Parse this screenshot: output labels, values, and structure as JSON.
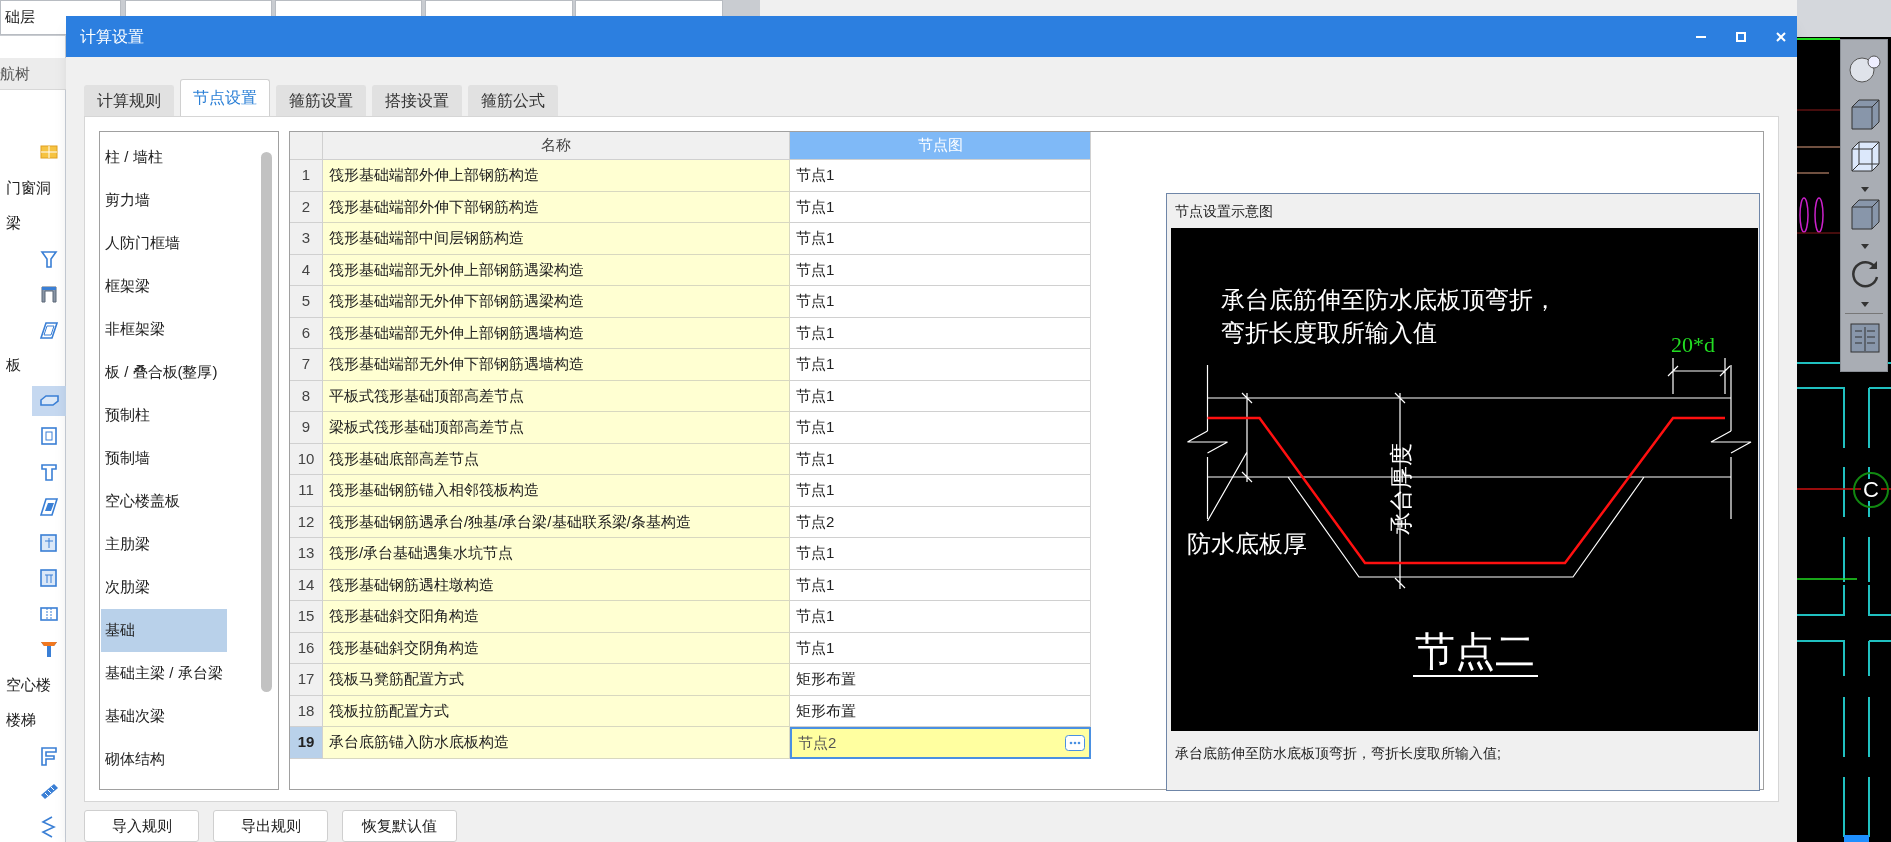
{
  "background": {
    "fields": [
      "础层"
    ],
    "nav_title": "航树",
    "nav_items": [
      {
        "kind": "icon",
        "selected": false
      },
      {
        "kind": "label",
        "text": "门窗洞",
        "selected": false
      },
      {
        "kind": "label",
        "text": "梁",
        "selected": false
      },
      {
        "kind": "icon",
        "selected": false
      },
      {
        "kind": "icon",
        "selected": false
      },
      {
        "kind": "icon",
        "selected": false
      },
      {
        "kind": "label",
        "text": "板",
        "selected": false
      },
      {
        "kind": "icon",
        "selected": true
      },
      {
        "kind": "icon",
        "selected": false
      },
      {
        "kind": "icon",
        "selected": false
      },
      {
        "kind": "icon",
        "selected": false
      },
      {
        "kind": "icon",
        "selected": false
      },
      {
        "kind": "icon",
        "selected": false
      },
      {
        "kind": "icon",
        "selected": false
      },
      {
        "kind": "icon",
        "selected": false
      },
      {
        "kind": "label",
        "text": "空心楼",
        "selected": false
      },
      {
        "kind": "label",
        "text": "楼梯",
        "selected": false
      },
      {
        "kind": "icon",
        "selected": false
      },
      {
        "kind": "icon",
        "selected": false
      },
      {
        "kind": "icon",
        "selected": false
      }
    ]
  },
  "dialog": {
    "title": "计算设置",
    "tabs": [
      {
        "label": "计算规则",
        "selected": false
      },
      {
        "label": "节点设置",
        "selected": true
      },
      {
        "label": "箍筋设置",
        "selected": false
      },
      {
        "label": "搭接设置",
        "selected": false
      },
      {
        "label": "箍筋公式",
        "selected": false
      }
    ],
    "categories": [
      {
        "label": "柱 / 墙柱",
        "selected": false
      },
      {
        "label": "剪力墙",
        "selected": false
      },
      {
        "label": "人防门框墙",
        "selected": false
      },
      {
        "label": "框架梁",
        "selected": false
      },
      {
        "label": "非框架梁",
        "selected": false
      },
      {
        "label": "板 / 叠合板(整厚)",
        "selected": false
      },
      {
        "label": "预制柱",
        "selected": false
      },
      {
        "label": "预制墙",
        "selected": false
      },
      {
        "label": "空心楼盖板",
        "selected": false
      },
      {
        "label": "主肋梁",
        "selected": false
      },
      {
        "label": "次肋梁",
        "selected": false
      },
      {
        "label": "基础",
        "selected": true
      },
      {
        "label": "基础主梁 / 承台梁",
        "selected": false
      },
      {
        "label": "基础次梁",
        "selected": false
      },
      {
        "label": "砌体结构",
        "selected": false
      }
    ],
    "table": {
      "columns": [
        {
          "label": "名称",
          "selected": false
        },
        {
          "label": "节点图",
          "selected": true
        }
      ],
      "rows": [
        {
          "num": "1",
          "name": "筏形基础端部外伸上部钢筋构造",
          "value": "节点1",
          "selected": false
        },
        {
          "num": "2",
          "name": "筏形基础端部外伸下部钢筋构造",
          "value": "节点1",
          "selected": false
        },
        {
          "num": "3",
          "name": "筏形基础端部中间层钢筋构造",
          "value": "节点1",
          "selected": false
        },
        {
          "num": "4",
          "name": "筏形基础端部无外伸上部钢筋遇梁构造",
          "value": "节点1",
          "selected": false
        },
        {
          "num": "5",
          "name": "筏形基础端部无外伸下部钢筋遇梁构造",
          "value": "节点1",
          "selected": false
        },
        {
          "num": "6",
          "name": "筏形基础端部无外伸上部钢筋遇墙构造",
          "value": "节点1",
          "selected": false
        },
        {
          "num": "7",
          "name": "筏形基础端部无外伸下部钢筋遇墙构造",
          "value": "节点1",
          "selected": false
        },
        {
          "num": "8",
          "name": "平板式筏形基础顶部高差节点",
          "value": "节点1",
          "selected": false
        },
        {
          "num": "9",
          "name": "梁板式筏形基础顶部高差节点",
          "value": "节点1",
          "selected": false
        },
        {
          "num": "10",
          "name": "筏形基础底部高差节点",
          "value": "节点1",
          "selected": false
        },
        {
          "num": "11",
          "name": "筏形基础钢筋锚入相邻筏板构造",
          "value": "节点1",
          "selected": false
        },
        {
          "num": "12",
          "name": "筏形基础钢筋遇承台/独基/承台梁/基础联系梁/条基构造",
          "value": "节点2",
          "selected": false
        },
        {
          "num": "13",
          "name": "筏形/承台基础遇集水坑节点",
          "value": "节点1",
          "selected": false
        },
        {
          "num": "14",
          "name": "筏形基础钢筋遇柱墩构造",
          "value": "节点1",
          "selected": false
        },
        {
          "num": "15",
          "name": "筏形基础斜交阳角构造",
          "value": "节点1",
          "selected": false
        },
        {
          "num": "16",
          "name": "筏形基础斜交阴角构造",
          "value": "节点1",
          "selected": false
        },
        {
          "num": "17",
          "name": "筏板马凳筋配置方式",
          "value": "矩形布置",
          "selected": false
        },
        {
          "num": "18",
          "name": "筏板拉筋配置方式",
          "value": "矩形布置",
          "selected": false
        },
        {
          "num": "19",
          "name": "承台底筋锚入防水底板构造",
          "value": "节点2",
          "selected": true
        }
      ]
    },
    "preview": {
      "title": "节点设置示意图",
      "note_lines": [
        "承台底筋伸至防水底板顶弯折，",
        "弯折长度取所输入值"
      ],
      "dimension": "20*d",
      "height_label": "承台厚度",
      "slab_label": "防水底板厚",
      "node_name": "节点二",
      "caption": "承台底筋伸至防水底板顶弯折，弯折长度取所输入值;"
    },
    "buttons": [
      "导入规则",
      "导出规则",
      "恢复默认值"
    ]
  },
  "viewport": {
    "axis_label": "C"
  }
}
